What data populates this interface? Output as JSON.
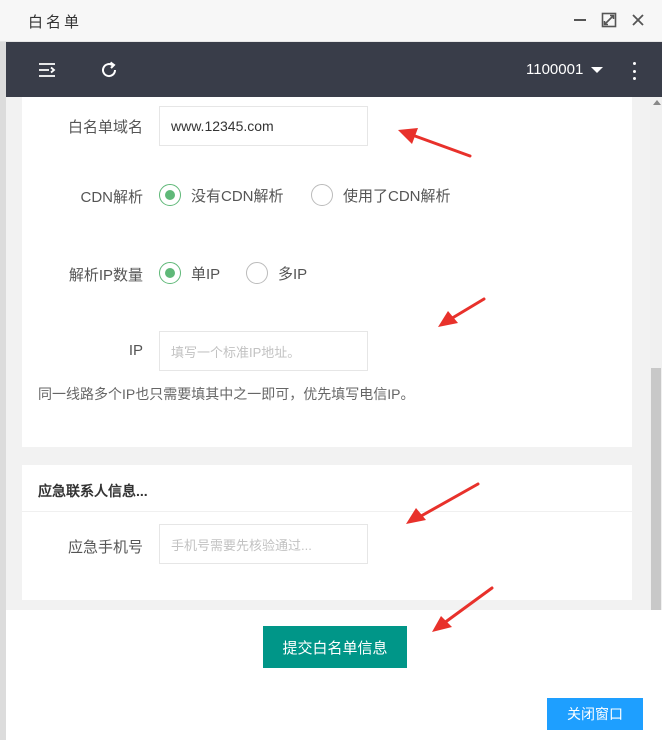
{
  "window": {
    "title": "白名单"
  },
  "topbar": {
    "user": "1100001"
  },
  "form": {
    "domain_label": "白名单域名",
    "domain_value": "www.12345.com",
    "cdn_label": "CDN解析",
    "cdn_options": [
      "没有CDN解析",
      "使用了CDN解析"
    ],
    "cdn_selected": "没有CDN解析",
    "ipcount_label": "解析IP数量",
    "ipcount_options": [
      "单IP",
      "多IP"
    ],
    "ipcount_selected": "单IP",
    "ip_label": "IP",
    "ip_placeholder": "填写一个标准IP地址。",
    "ip_hint": "同一线路多个IP也只需要填其中之一即可，优先填写电信IP。"
  },
  "contact": {
    "section_title": "应急联系人信息...",
    "phone_label": "应急手机号",
    "phone_placeholder": "手机号需要先核验通过..."
  },
  "actions": {
    "submit_label": "提交白名单信息",
    "close_label": "关闭窗口"
  },
  "colors": {
    "topbar": "#393d49",
    "radio_selected": "#5fb878",
    "submit": "#009688",
    "close": "#1e9fff",
    "annotation_arrow": "#e8312b"
  },
  "icons": {
    "menu": "menu-fold-icon",
    "refresh": "refresh-icon",
    "more": "more-vertical-icon",
    "minimize": "minimize-icon",
    "maximize": "maximize-icon",
    "close": "close-icon"
  }
}
